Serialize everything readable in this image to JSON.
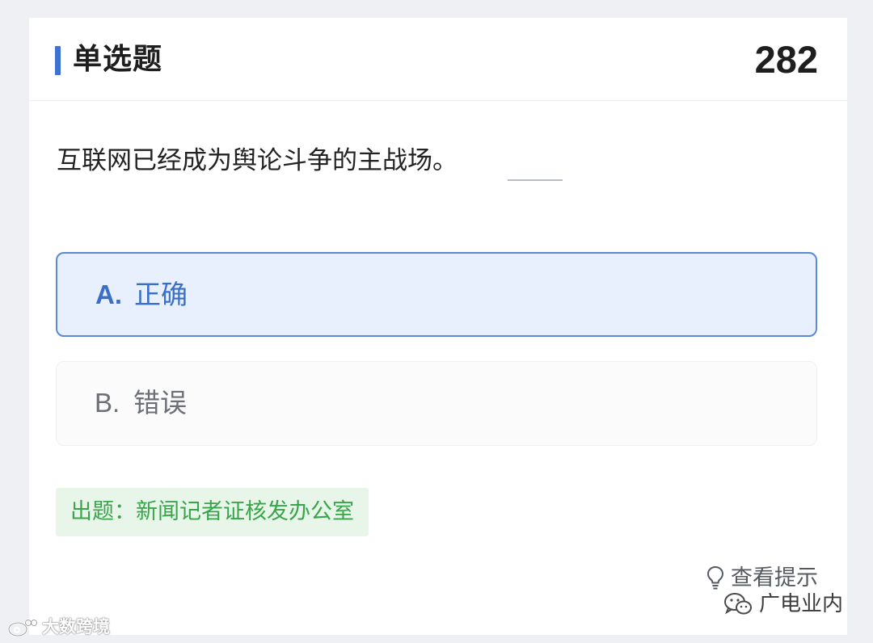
{
  "header": {
    "title": "单选题",
    "question_number": "282"
  },
  "question": {
    "text": "互联网已经成为舆论斗争的主战场。"
  },
  "options": [
    {
      "letter": "A.",
      "text": "正确",
      "selected": true
    },
    {
      "letter": "B.",
      "text": "错误",
      "selected": false
    }
  ],
  "source": {
    "label": "出题：",
    "value": "新闻记者证核发办公室"
  },
  "hint": {
    "label": "查看提示",
    "icon": "lightbulb-icon"
  },
  "watermarks": {
    "wechat_account": "广电业内",
    "weibo_account": "大数跨境",
    "wechat_icon": "wechat-icon",
    "weibo_icon": "weibo-icon"
  },
  "colors": {
    "accent": "#3d72d2",
    "selected_bg": "#e8f0fe",
    "source_bg": "#e8f6ea",
    "source_text": "#39a54a"
  }
}
